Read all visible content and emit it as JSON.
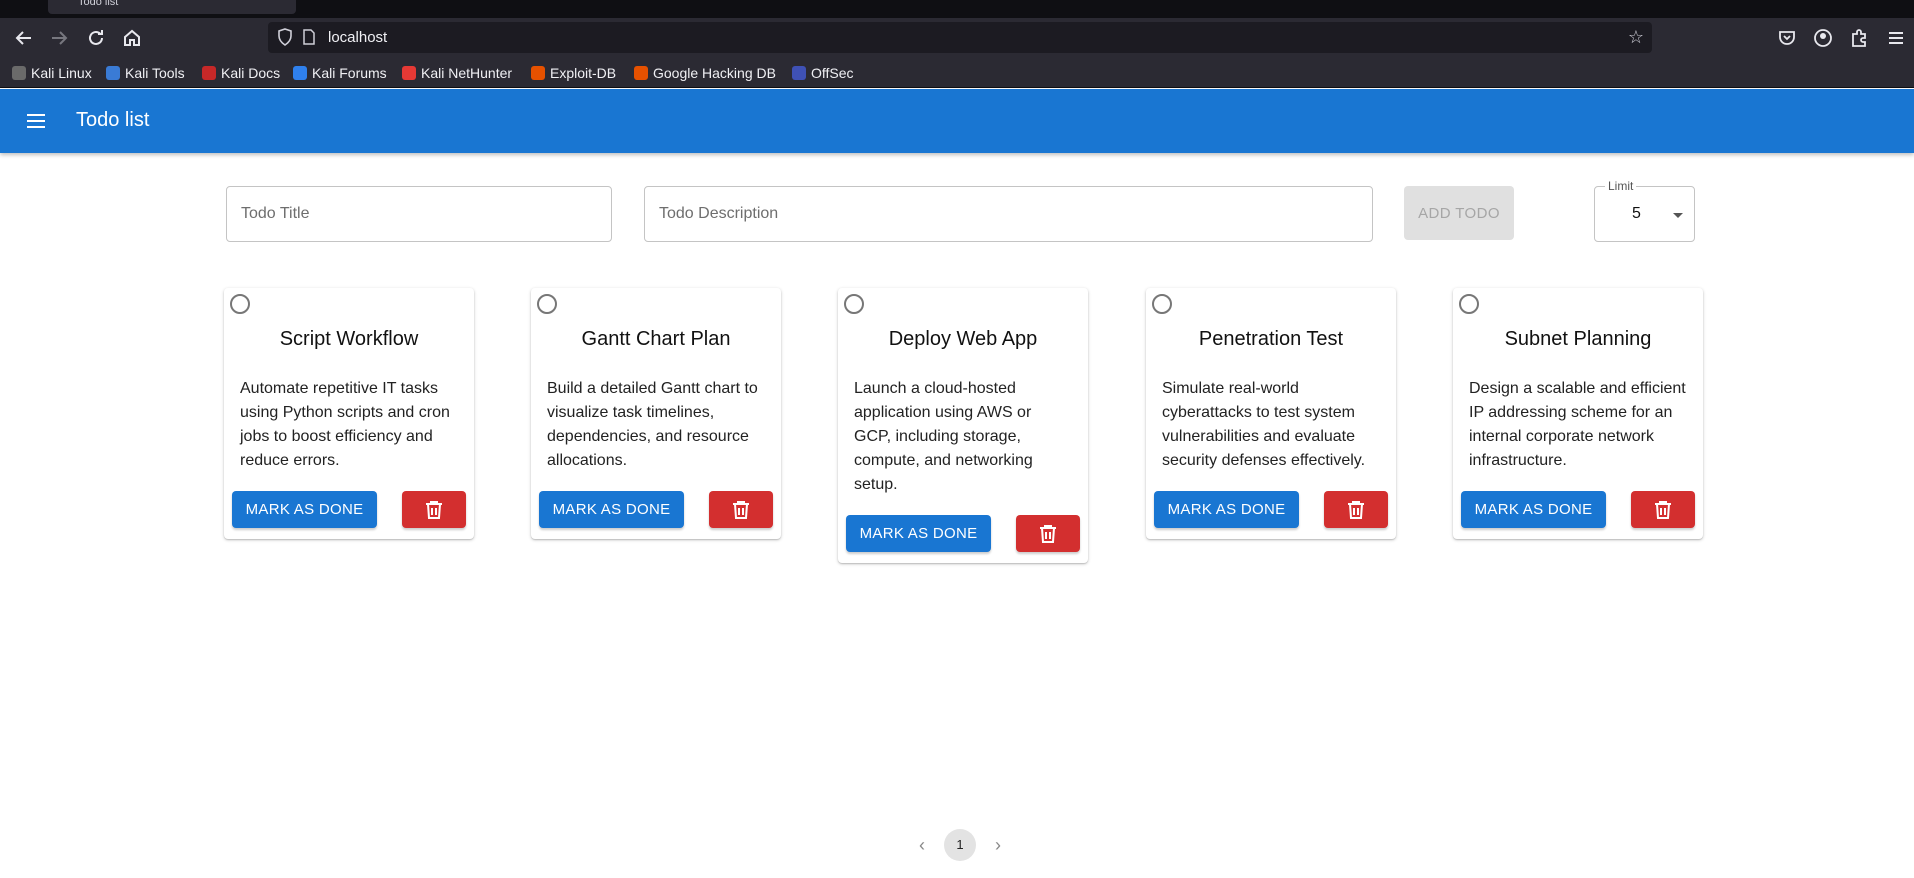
{
  "browser": {
    "tab_title": "Todo list",
    "url": "localhost",
    "bookmarks": [
      {
        "label": "Kali Linux",
        "color": "#6a6a6a"
      },
      {
        "label": "Kali Tools",
        "color": "#3a7bd5"
      },
      {
        "label": "Kali Docs",
        "color": "#c62828"
      },
      {
        "label": "Kali Forums",
        "color": "#2f80ed"
      },
      {
        "label": "Kali NetHunter",
        "color": "#e53935"
      },
      {
        "label": "Exploit-DB",
        "color": "#e65100"
      },
      {
        "label": "Google Hacking DB",
        "color": "#e65100"
      },
      {
        "label": "OffSec",
        "color": "#3f51b5"
      }
    ]
  },
  "appbar": {
    "title": "Todo list",
    "color": "#1976d2"
  },
  "form": {
    "title_placeholder": "Todo Title",
    "description_placeholder": "Todo Description",
    "add_label": "ADD TODO",
    "limit_label": "Limit",
    "limit_value": "5"
  },
  "todos": [
    {
      "title": "Script Workflow",
      "description": "Automate repetitive IT tasks using Python scripts and cron jobs to boost efficiency and reduce errors.",
      "done_label": "MARK AS DONE"
    },
    {
      "title": "Gantt Chart Plan",
      "description": "Build a detailed Gantt chart to visualize task timelines, dependencies, and resource allocations.",
      "done_label": "MARK AS DONE"
    },
    {
      "title": "Deploy Web App",
      "description": "Launch a cloud-hosted application using AWS or GCP, including storage, compute, and networking setup.",
      "done_label": "MARK AS DONE"
    },
    {
      "title": "Penetration Test",
      "description": "Simulate real-world cyberattacks to test system vulnerabilities and evaluate security defenses effectively.",
      "done_label": "MARK AS DONE"
    },
    {
      "title": "Subnet Planning",
      "description": "Design a scalable and efficient IP addressing scheme for an internal corporate network infrastructure.",
      "done_label": "MARK AS DONE"
    }
  ],
  "pagination": {
    "current_page": "1"
  },
  "colors": {
    "primary": "#1976d2",
    "danger": "#d32f2f"
  }
}
